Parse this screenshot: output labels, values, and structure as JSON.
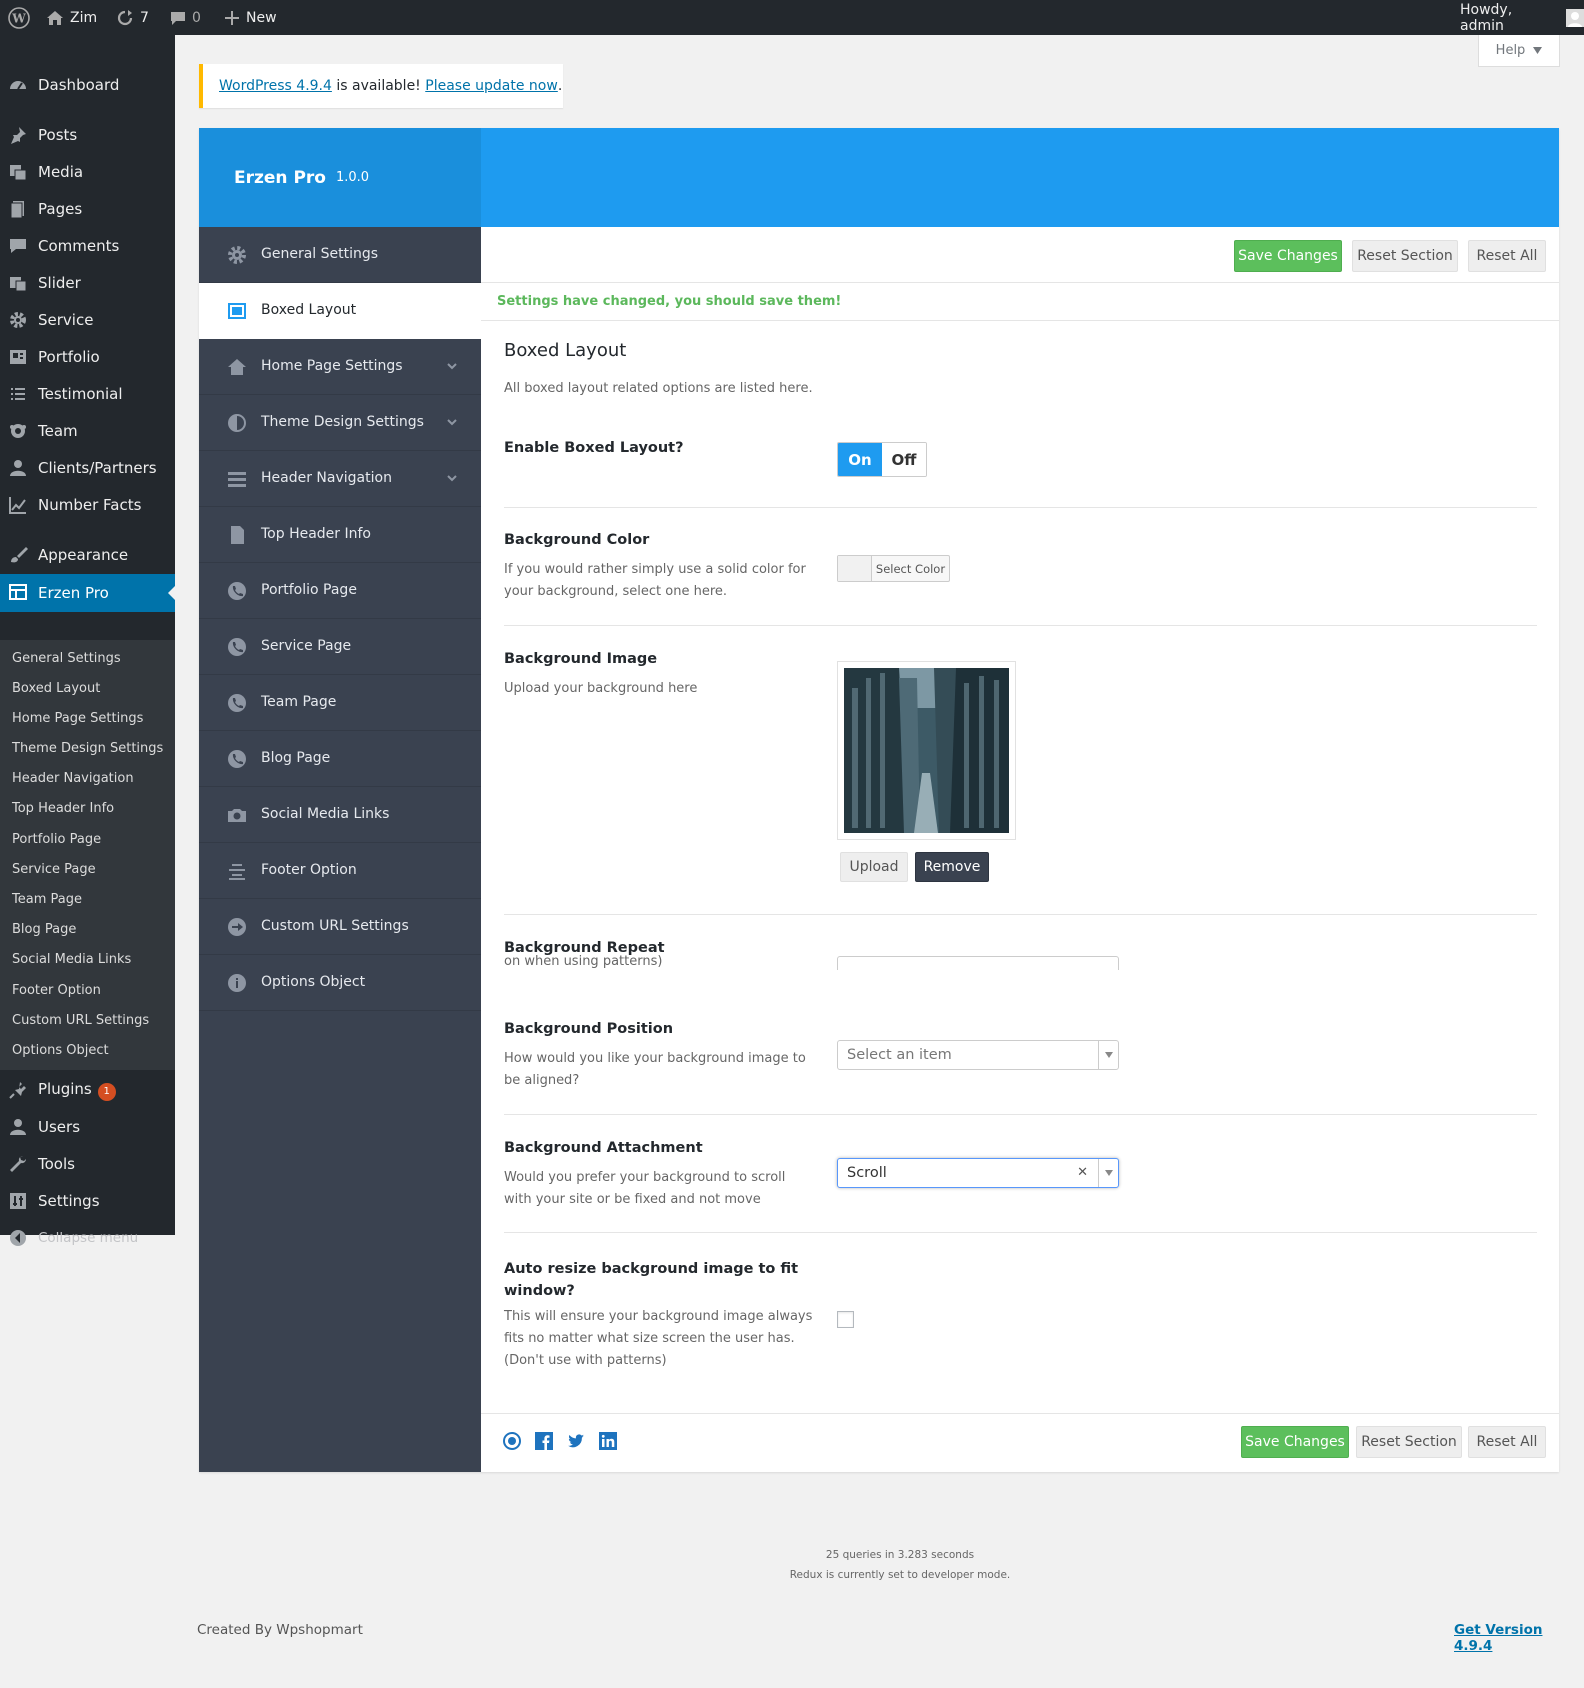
{
  "adminbar": {
    "site_name": "Zim",
    "updates_count": "7",
    "comments_count": "0",
    "new_label": "New",
    "howdy": "Howdy, admin"
  },
  "sidebar": {
    "items": [
      {
        "label": "Dashboard",
        "icon": "dashboard-icon"
      },
      {
        "label": "Posts",
        "icon": "pin-icon"
      },
      {
        "label": "Media",
        "icon": "media-icon"
      },
      {
        "label": "Pages",
        "icon": "page-icon"
      },
      {
        "label": "Comments",
        "icon": "comment-icon"
      },
      {
        "label": "Slider",
        "icon": "slider-icon"
      },
      {
        "label": "Service",
        "icon": "gear-icon"
      },
      {
        "label": "Portfolio",
        "icon": "portfolio-icon"
      },
      {
        "label": "Testimonial",
        "icon": "list-icon"
      },
      {
        "label": "Team",
        "icon": "team-icon"
      },
      {
        "label": "Clients/Partners",
        "icon": "user-icon"
      },
      {
        "label": "Number Facts",
        "icon": "chart-icon"
      },
      {
        "label": "Appearance",
        "icon": "brush-icon"
      },
      {
        "label": "Erzen Pro",
        "icon": "grid-icon"
      },
      {
        "label": "Plugins",
        "icon": "plugin-icon",
        "badge": "1"
      },
      {
        "label": "Users",
        "icon": "user-icon"
      },
      {
        "label": "Tools",
        "icon": "wrench-icon"
      },
      {
        "label": "Settings",
        "icon": "settings-icon"
      },
      {
        "label": "Collapse menu",
        "icon": "collapse-icon"
      }
    ],
    "submenu": [
      "General Settings",
      "Boxed Layout",
      "Home Page Settings",
      "Theme Design Settings",
      "Header Navigation",
      "Top Header Info",
      "Portfolio Page",
      "Service Page",
      "Team Page",
      "Blog Page",
      "Social Media Links",
      "Footer Option",
      "Custom URL Settings",
      "Options Object"
    ]
  },
  "help_label": "Help",
  "notice": {
    "link1": "WordPress 4.9.4",
    "mid": " is available! ",
    "link2": "Please update now",
    "end": "."
  },
  "redux": {
    "brand": "Erzen Pro",
    "version": "1.0.0",
    "nav": [
      {
        "label": "General Settings",
        "icon": "gear-icon"
      },
      {
        "label": "Boxed Layout",
        "icon": "layout-icon"
      },
      {
        "label": "Home Page Settings",
        "icon": "home-icon"
      },
      {
        "label": "Theme Design Settings",
        "icon": "contrast-icon"
      },
      {
        "label": "Header Navigation",
        "icon": "menu-icon"
      },
      {
        "label": "Top Header Info",
        "icon": "document-icon"
      },
      {
        "label": "Portfolio Page",
        "icon": "phone-icon"
      },
      {
        "label": "Service Page",
        "icon": "phone-icon"
      },
      {
        "label": "Team Page",
        "icon": "phone-icon"
      },
      {
        "label": "Blog Page",
        "icon": "phone-icon"
      },
      {
        "label": "Social Media Links",
        "icon": "camera-icon"
      },
      {
        "label": "Footer Option",
        "icon": "align-icon"
      },
      {
        "label": "Custom URL Settings",
        "icon": "arrow-circle-icon"
      },
      {
        "label": "Options Object",
        "icon": "info-icon"
      }
    ],
    "save_label": "Save Changes",
    "reset_section_label": "Reset Section",
    "reset_all_label": "Reset All",
    "changed_notice": "Settings have changed, you should save them!",
    "section_title": "Boxed Layout",
    "section_desc": "All boxed layout related options are listed here.",
    "fields": {
      "enable_title": "Enable Boxed Layout?",
      "on": "On",
      "off": "Off",
      "bgcolor_title": "Background Color",
      "bgcolor_desc": "If you would rather simply use a solid color for your background, select one here.",
      "select_color": "Select Color",
      "bgimage_title": "Background Image",
      "bgimage_desc": "Upload your background here",
      "upload": "Upload",
      "remove": "Remove",
      "repeat_title": "Background Repeat",
      "repeat_desc": "on when using patterns)",
      "position_title": "Background Position",
      "position_desc": "How would you like your background image to be aligned?",
      "position_placeholder": "Select an item",
      "attach_title": "Background Attachment",
      "attach_desc": "Would you prefer your background to scroll with your site or be fixed and not move",
      "attach_value": "Scroll",
      "resize_title": "Auto resize background image to fit window?",
      "resize_desc": "This will ensure your background image always fits no matter what size screen the user has. (Don't use with patterns)"
    }
  },
  "footer": {
    "queries": "25 queries in 3.283 seconds",
    "devmode": "Redux is currently set to developer mode.",
    "credit": "Created By Wpshopmart",
    "get_version": "Get Version 4.9.4"
  },
  "colors": {
    "accent": "#1e9bf0",
    "save_green": "#5cbf5c",
    "sidebar_bg": "#23282d",
    "redux_nav_bg": "#3a4250"
  }
}
